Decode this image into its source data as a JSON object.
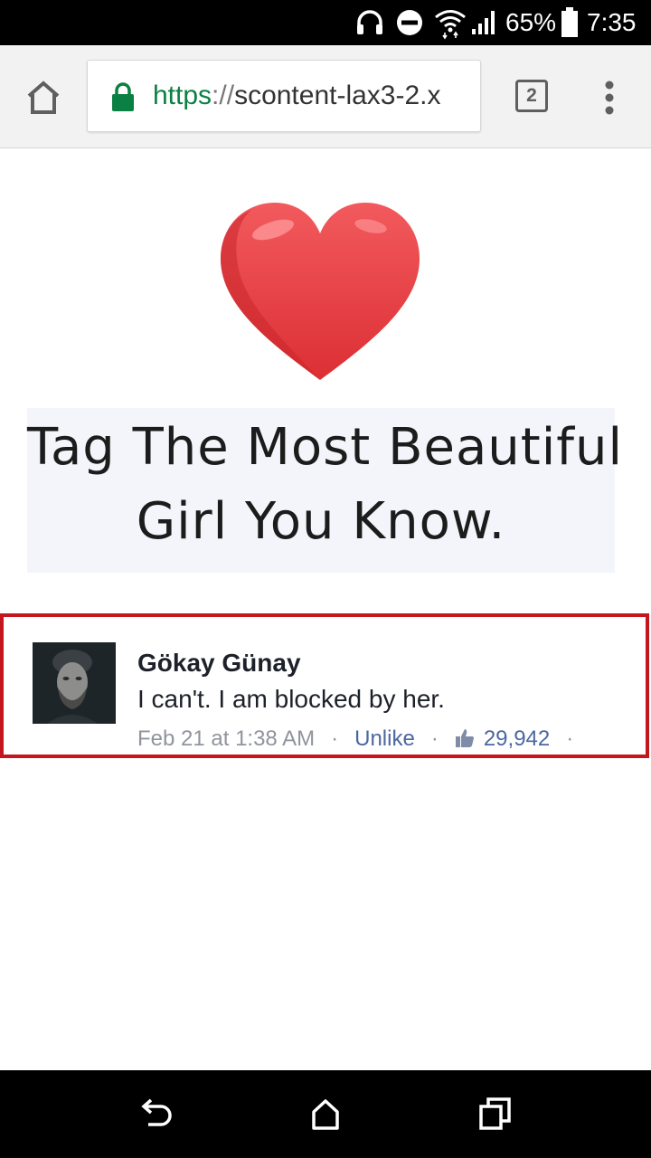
{
  "status_bar": {
    "battery_percent": "65%",
    "time": "7:35",
    "icons": [
      "headphones-icon",
      "do-not-disturb-icon",
      "wifi-icon",
      "cell-signal-icon",
      "battery-icon"
    ]
  },
  "browser": {
    "url": {
      "scheme": "https",
      "separator": "://",
      "host": "scontent-lax3-2.x"
    },
    "tab_count": "2",
    "icons": [
      "home-icon",
      "lock-icon",
      "tabs-icon",
      "more-vert-icon"
    ],
    "accent_color": "#0b8043"
  },
  "post": {
    "heart_color": "#e8383d",
    "caption_line_1": "Tag The Most Beautiful",
    "caption_line_2": "Girl You Know."
  },
  "comment": {
    "author": "Gökay Günay",
    "text": "I can't. I am blocked by her.",
    "timestamp": "Feb 21 at 1:38 AM",
    "action_label": "Unlike",
    "like_count": "29,942",
    "separator": "·",
    "highlight_color": "#c4161c"
  },
  "nav_bar": {
    "icons": [
      "back-icon",
      "home-icon",
      "recents-icon"
    ]
  }
}
